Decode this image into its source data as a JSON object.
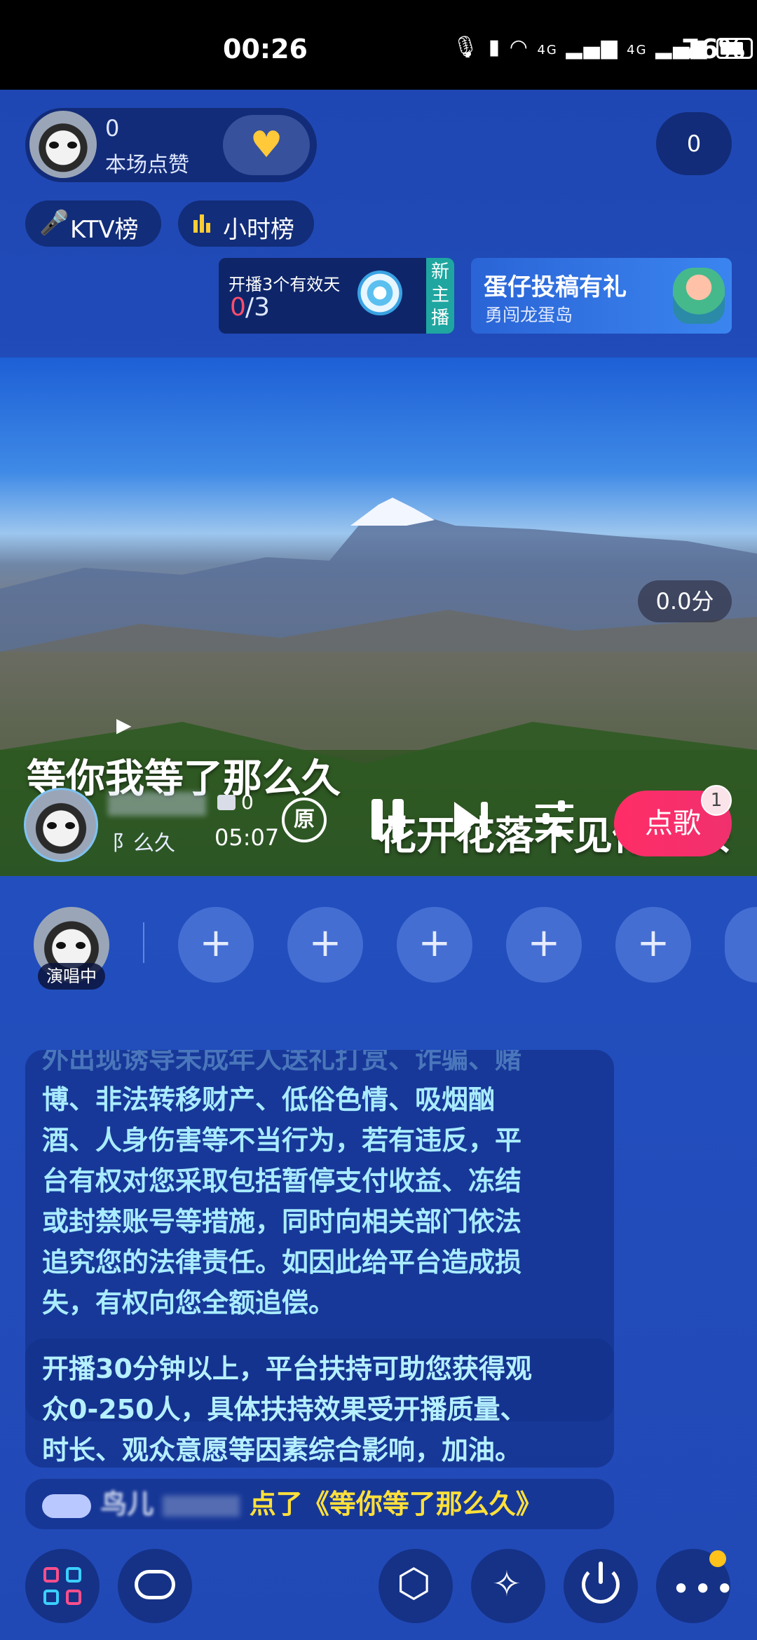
{
  "status_bar": {
    "time": "00:26",
    "network_1": "4G",
    "network_2": "4G",
    "battery_pct": "76%"
  },
  "header": {
    "likes_count": "0",
    "likes_label": "本场点赞",
    "viewer_count": "0",
    "ktv_rank_label": "KTV榜",
    "hour_rank_label": "小时榜"
  },
  "promo": {
    "task_title": "开播3个有效天",
    "task_done": "0",
    "task_total": "/3",
    "new_host_badge": "新主播",
    "event_title": "蛋仔投稿有礼",
    "event_subtitle": "勇闯龙蛋岛"
  },
  "video": {
    "score": "0.0分",
    "lyric_line_1": "等你我等了那么久",
    "lyric_line_2": "花开花落不见你回头",
    "singer_song_fragment": "阝么久",
    "gift_count": "0",
    "time": "05:07",
    "original_label": "原",
    "order_song_label": "点歌",
    "order_badge": "1"
  },
  "seats": {
    "singing_label": "演唱中",
    "plus": "+"
  },
  "chat": {
    "notice_top_fragment": "外出现诱导未成年人送礼打赏、诈骗、赌",
    "notice_lines": [
      "博、非法转移财产、低俗色情、吸烟酗",
      "酒、人身伤害等不当行为，若有违反，平",
      "台有权对您采取包括暂停支付收益、冻结",
      "或封禁账号等措施，同时向相关部门依法",
      "追究您的法律责任。如因此给平台造成损",
      "失，有权向您全额追偿。"
    ],
    "support_lines": [
      "开播30分钟以上，平台扶持可助您获得观",
      "众0-250人，具体扶持效果受开播质量、",
      "时长、观众意愿等因素综合影响，加油。"
    ],
    "order_msg_prefix": "鸟儿",
    "order_msg": "点了《等你等了那么久》"
  },
  "colors": {
    "background": "#1f47b3",
    "accent_pink": "#f0306e",
    "chat_text": "#a9ecff",
    "order_text": "#ffe03a"
  }
}
